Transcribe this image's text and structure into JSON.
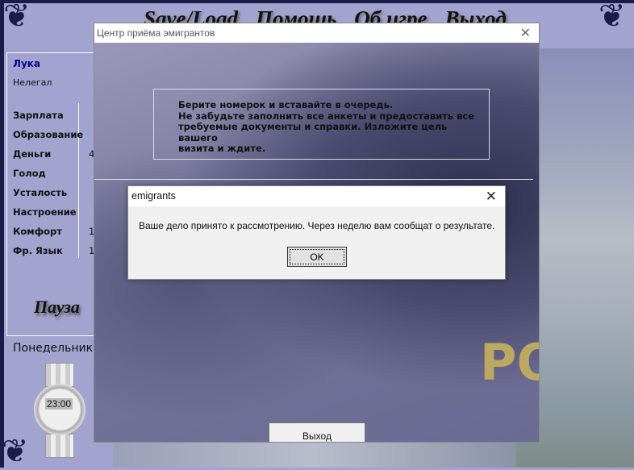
{
  "menu": [
    "Save/Load",
    "Помощь",
    "Об игре",
    "Выход"
  ],
  "player": {
    "name": "Лука",
    "status": "Нелегал"
  },
  "stats": [
    {
      "label": "Зарплата",
      "value": ""
    },
    {
      "label": "Образование",
      "value": ""
    },
    {
      "label": "Деньги",
      "value": "4"
    },
    {
      "label": "Голод",
      "value": ""
    },
    {
      "label": "Усталость",
      "value": ""
    },
    {
      "label": "Настроение",
      "value": ""
    },
    {
      "label": "Комфорт",
      "value": "1"
    },
    {
      "label": "Фр. Язык",
      "value": "1"
    }
  ],
  "pause_label": "Пауза",
  "day": "Понедельник",
  "clock": "23:00",
  "window": {
    "title": "Центр приёма эмигрантов",
    "close": "✕",
    "info": [
      "Берите номерок и вставайте в очередь.",
      "Не забудьте заполнить все анкеты и предоставить все",
      "требуемые документы и справки. Изложите цель вашего",
      "визита и ждите."
    ],
    "exit_label": "Выход",
    "sign": "PO"
  },
  "dialog": {
    "title": "emigrants",
    "close": "✕",
    "message": "Ваше дело принято к рассмотрению. Через неделю вам сообщат о результате.",
    "ok_label": "OK"
  }
}
